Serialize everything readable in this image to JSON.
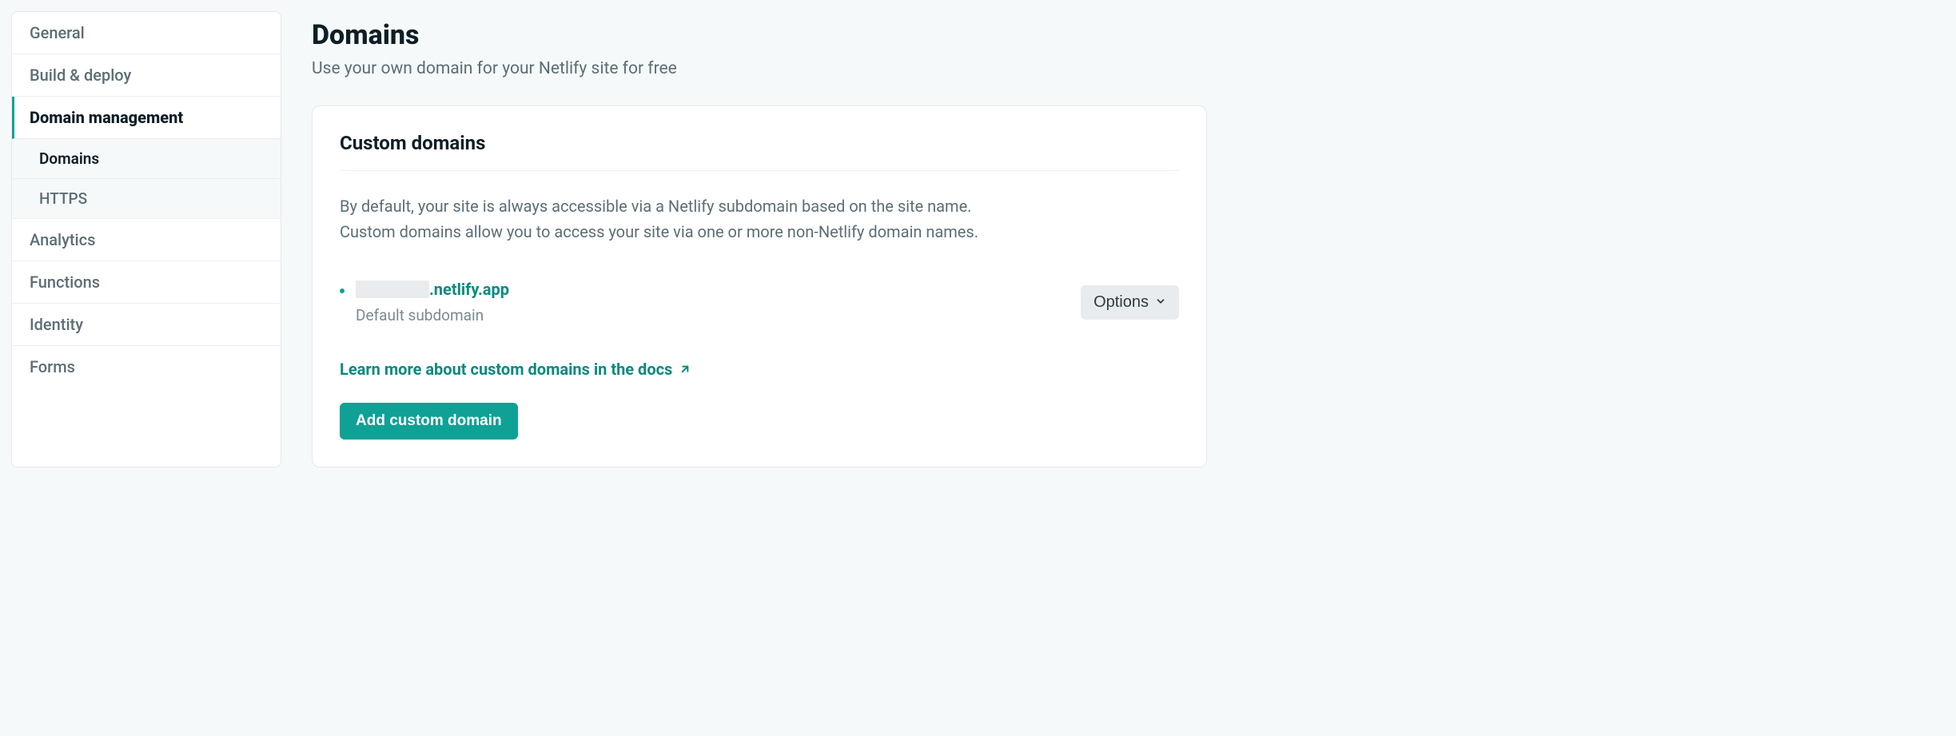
{
  "sidebar": {
    "items": [
      {
        "label": "General"
      },
      {
        "label": "Build & deploy"
      },
      {
        "label": "Domain management"
      },
      {
        "label": "Analytics"
      },
      {
        "label": "Functions"
      },
      {
        "label": "Identity"
      },
      {
        "label": "Forms"
      }
    ],
    "sub": {
      "domains": "Domains",
      "https": "HTTPS"
    }
  },
  "header": {
    "title": "Domains",
    "subtitle": "Use your own domain for your Netlify site for free"
  },
  "card": {
    "title": "Custom domains",
    "desc_line1": "By default, your site is always accessible via a Netlify subdomain based on the site name.",
    "desc_line2": "Custom domains allow you to access your site via one or more non-Netlify domain names.",
    "domain": {
      "suffix": ".netlify.app",
      "sublabel": "Default subdomain"
    },
    "options_label": "Options",
    "learn_more": "Learn more about custom domains in the docs",
    "add_button": "Add custom domain"
  }
}
